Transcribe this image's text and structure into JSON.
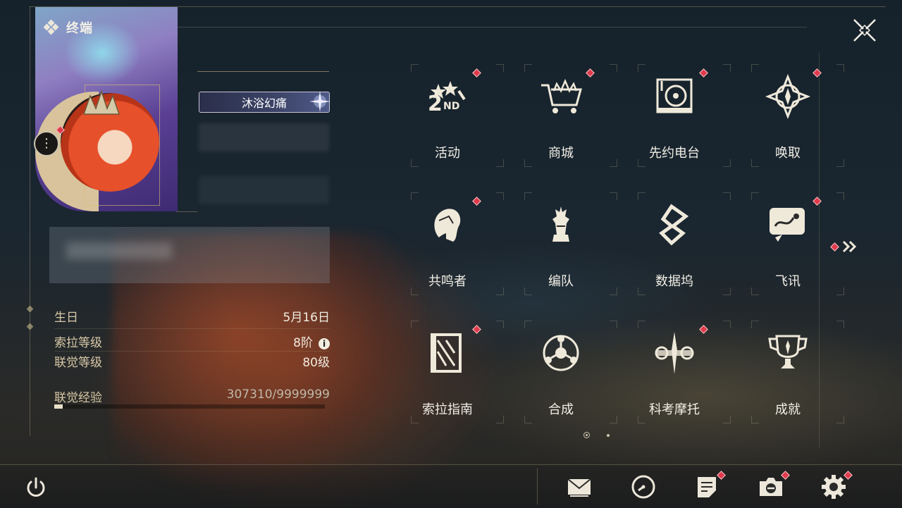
{
  "window": {
    "title": "终端"
  },
  "profile": {
    "namecard_title": "沐浴幻痛",
    "birthday_label": "生日",
    "birthday_value": "5月16日",
    "sola_level_label": "索拉等级",
    "sola_level_value": "8阶",
    "union_level_label": "联觉等级",
    "union_level_value": "80级",
    "union_exp_label": "联觉经验",
    "union_exp_value": "307310/9999999",
    "union_exp_progress": 0.031
  },
  "menu": {
    "items": [
      {
        "label": "活动",
        "icon": "event-2nd-anniversary-icon",
        "badge": true
      },
      {
        "label": "商城",
        "icon": "shop-cart-icon",
        "badge": true
      },
      {
        "label": "先约电台",
        "icon": "radio-icon",
        "badge": true
      },
      {
        "label": "唤取",
        "icon": "convene-icon",
        "badge": true
      },
      {
        "label": "共鸣者",
        "icon": "resonator-icon",
        "badge": true
      },
      {
        "label": "编队",
        "icon": "team-chess-icon",
        "badge": false
      },
      {
        "label": "数据坞",
        "icon": "data-bank-icon",
        "badge": false
      },
      {
        "label": "飞讯",
        "icon": "message-icon",
        "badge": true
      },
      {
        "label": "索拉指南",
        "icon": "guidebook-icon",
        "badge": true
      },
      {
        "label": "合成",
        "icon": "synthesis-icon",
        "badge": false
      },
      {
        "label": "科考摩托",
        "icon": "motorcycle-icon",
        "badge": true
      },
      {
        "label": "成就",
        "icon": "trophy-icon",
        "badge": false
      }
    ],
    "page_count": 2,
    "current_page": 1
  },
  "bottom_bar": {
    "icons": [
      "mail-icon",
      "clock-icon",
      "notice-icon",
      "camera-icon",
      "gear-icon"
    ]
  },
  "colors": {
    "badge_red": "#e03a4b",
    "accent_gold": "#cfb98a"
  }
}
